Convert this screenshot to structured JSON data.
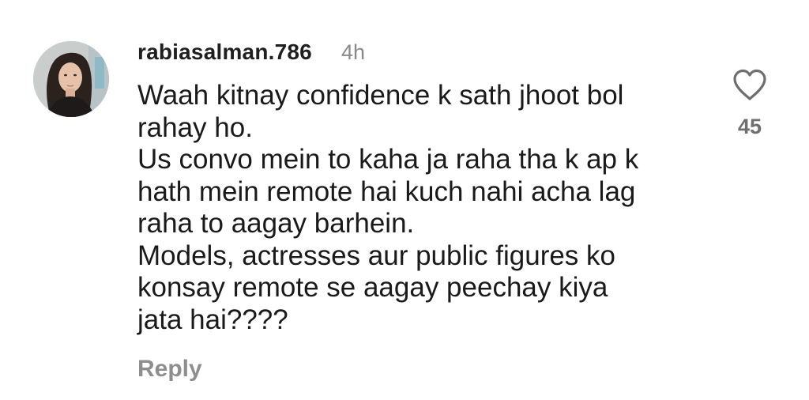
{
  "comment": {
    "username": "rabiasalman.786",
    "timestamp": "4h",
    "text_lines": [
      "Waah kitnay confidence k sath jhoot bol",
      "rahay ho.",
      "Us convo mein to kaha ja raha tha k ap k",
      "hath mein remote hai kuch nahi acha lag",
      "raha to aagay barhein.",
      "Models, actresses aur public figures ko",
      "konsay remote se aagay peechay kiya",
      "jata hai????"
    ],
    "reply_label": "Reply",
    "like_icon": "heart-outline-icon",
    "like_count": "45"
  },
  "colors": {
    "text": "#1a1a1a",
    "muted": "#8e8e8e",
    "count": "#6e6e6e"
  }
}
